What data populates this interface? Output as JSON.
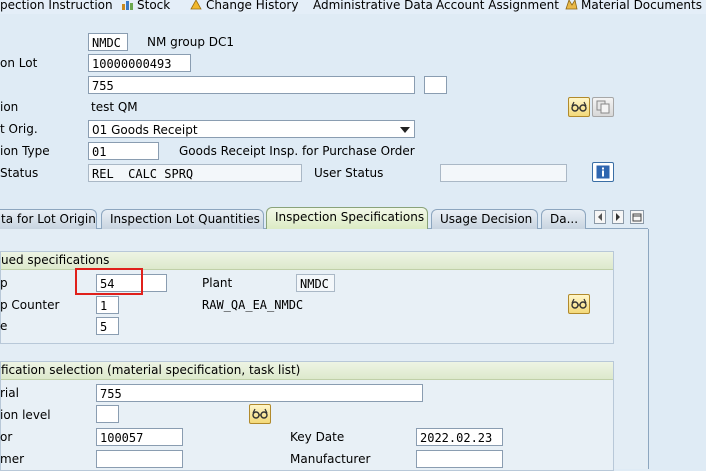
{
  "menu": {
    "items": [
      {
        "label": "pection Instruction",
        "icon": ""
      },
      {
        "label": "Stock",
        "icon": "stock-icon"
      },
      {
        "label": "Change History",
        "icon": "change-history-icon"
      },
      {
        "label": "Administrative Data",
        "icon": ""
      },
      {
        "label": "Account Assignment",
        "icon": ""
      },
      {
        "label": "Material Documents",
        "icon": "material-documents-icon"
      }
    ]
  },
  "header": {
    "plant_value": "NMDC",
    "plant_text": "NM group DC1",
    "lot_label": "on Lot",
    "lot_value": "10000000493",
    "material_value": "755",
    "desc_label": "ion",
    "desc_value": "test QM",
    "origin_label": "t Orig.",
    "origin_value": "01 Goods Receipt",
    "type_label": "ion Type",
    "type_value": "01",
    "type_text": "Goods Receipt Insp. for Purchase Order",
    "status_label": "Status",
    "system_status_value": "REL  CALC SPRQ",
    "user_status_label": "User Status",
    "user_status_value": ""
  },
  "tabs": [
    {
      "label": "ta for Lot Origin",
      "active": false
    },
    {
      "label": "Inspection Lot Quantities",
      "active": false
    },
    {
      "label": "Inspection Specifications",
      "active": true
    },
    {
      "label": "Usage Decision",
      "active": false
    },
    {
      "label": "Da...",
      "active": false
    }
  ],
  "group1": {
    "title": "ued specifications",
    "row1_label": "p",
    "row1_value": "54",
    "plant_label": "Plant",
    "plant_value": "NMDC",
    "row2_label": "p Counter",
    "row2_value": "1",
    "route_text": "RAW_QA_EA_NMDC",
    "row3_label": "e",
    "row3_value": "5"
  },
  "group2": {
    "title": "fication selection (material specification, task list)",
    "material_label": "rial",
    "material_value": "755",
    "level_label": "ion level",
    "level_value": "",
    "vendor_label": "or",
    "vendor_value": "100057",
    "key_date_label": "Key Date",
    "key_date_value": "2022.02.23",
    "customer_label": "mer",
    "customer_value": "",
    "manufacturer_label": "Manufacturer",
    "manufacturer_value": ""
  },
  "colors": {
    "background": "#dfebf5",
    "active_tab": "#dcebc4",
    "highlight": "#e0201b"
  }
}
